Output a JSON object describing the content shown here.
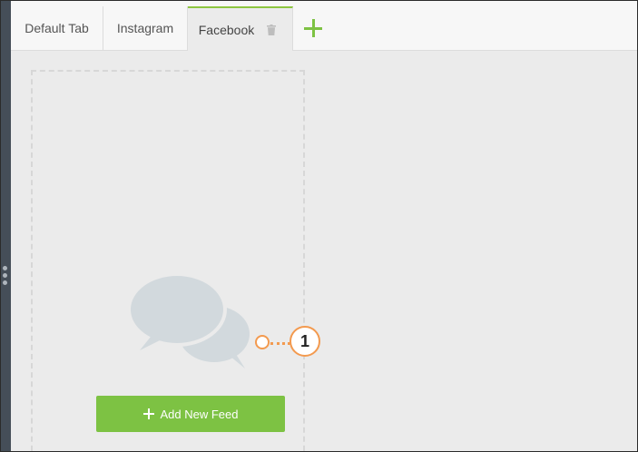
{
  "tabs": [
    {
      "label": "Default Tab",
      "active": false
    },
    {
      "label": "Instagram",
      "active": false
    },
    {
      "label": "Facebook",
      "active": true
    }
  ],
  "icons": {
    "delete_tab": "trash-icon",
    "add_tab": "plus-icon",
    "empty_state": "chat-bubbles-icon",
    "add_feed": "plus-icon"
  },
  "feed_column": {
    "add_button_label": "Add New Feed"
  },
  "callout": {
    "number": "1"
  },
  "colors": {
    "accent": "#7dc243",
    "callout": "#f39a4f",
    "placeholder_icon": "#d2d9dd"
  }
}
